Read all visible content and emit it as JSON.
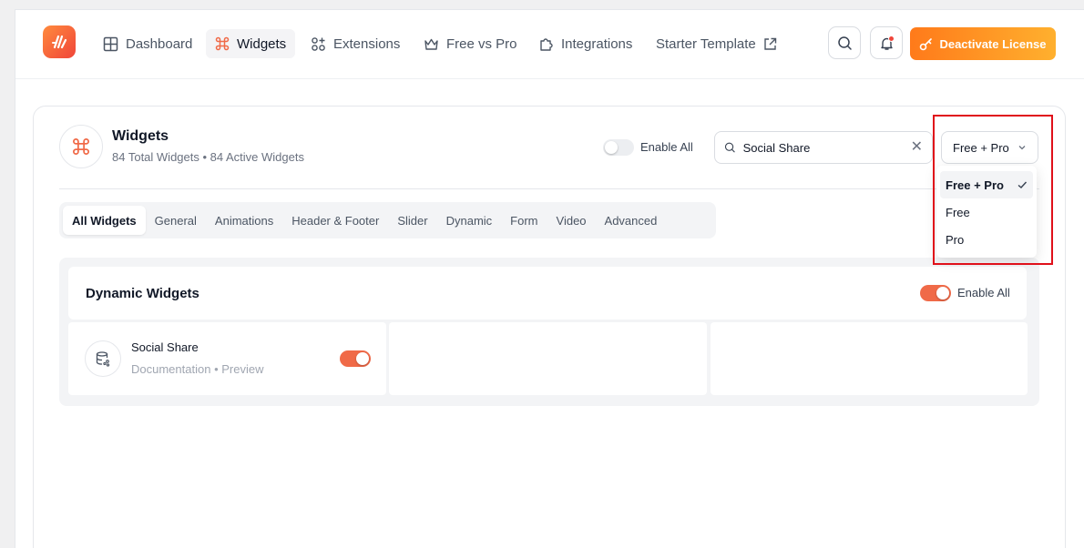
{
  "nav": {
    "items": [
      {
        "label": "Dashboard",
        "icon": "grid-icon"
      },
      {
        "label": "Widgets",
        "icon": "command-icon",
        "active": true
      },
      {
        "label": "Extensions",
        "icon": "extensions-icon"
      },
      {
        "label": "Free vs Pro",
        "icon": "crown-icon"
      },
      {
        "label": "Integrations",
        "icon": "puzzle-icon"
      },
      {
        "label": "Starter Template",
        "icon": "external-link-icon"
      }
    ],
    "license_button": "Deactivate License"
  },
  "header": {
    "title": "Widgets",
    "subtitle": "84 Total Widgets • 84 Active Widgets",
    "enable_all_label": "Enable All",
    "enable_all_on": false
  },
  "search": {
    "value": "Social Share",
    "placeholder": "Search"
  },
  "filter": {
    "selected": "Free + Pro",
    "options": [
      "Free + Pro",
      "Free",
      "Pro"
    ]
  },
  "tabs": [
    "All Widgets",
    "General",
    "Animations",
    "Header & Footer",
    "Slider",
    "Dynamic",
    "Form",
    "Video",
    "Advanced"
  ],
  "section": {
    "title": "Dynamic Widgets",
    "enable_all_label": "Enable All",
    "enable_all_on": true
  },
  "widgets": [
    {
      "name": "Social Share",
      "doc_label": "Documentation",
      "separator": "•",
      "preview_label": "Preview",
      "enabled": true
    }
  ],
  "colors": {
    "accent": "#f06a48",
    "license_gradient_start": "#ff7a1a",
    "license_gradient_end": "#ffb02e",
    "highlight": "#e0101a"
  }
}
